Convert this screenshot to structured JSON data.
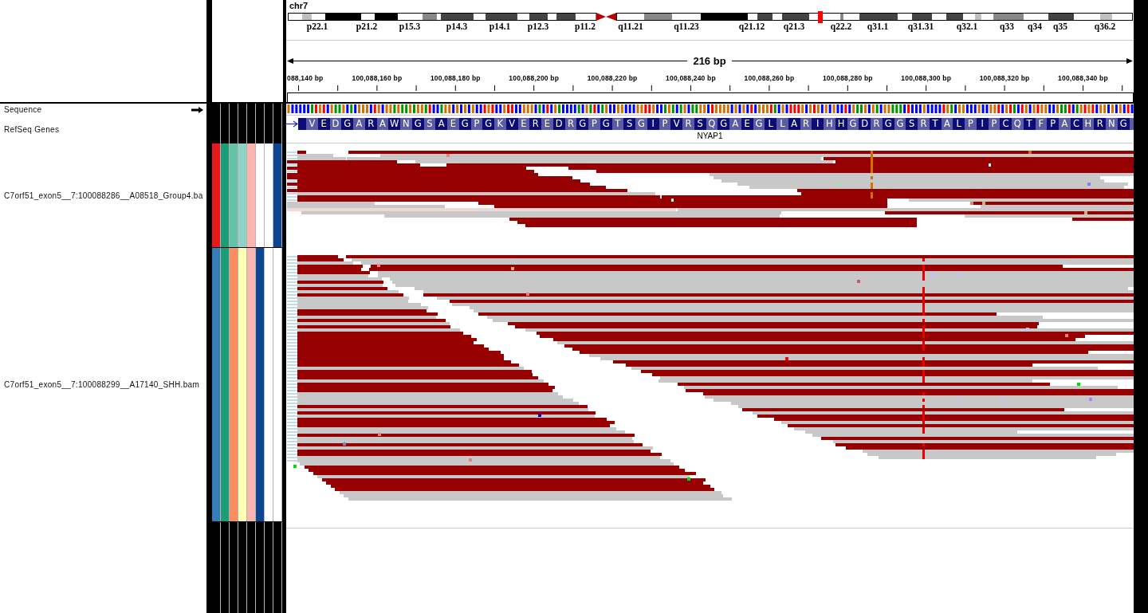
{
  "header": {
    "chromosome": "chr7",
    "band_labels": [
      "p22.1",
      "p21.2",
      "p15.3",
      "p14.3",
      "p14.1",
      "p12.3",
      "p11.2",
      "q11.21",
      "q11.23",
      "q21.12",
      "q21.3",
      "q22.2",
      "q31.1",
      "q31.31",
      "q32.1",
      "q33",
      "q34",
      "q35",
      "q36.2"
    ],
    "ruler": {
      "span": "216 bp",
      "tick_labels": [
        "088,140 bp",
        "100,088,160 bp",
        "100,088,180 bp",
        "100,088,200 bp",
        "100,088,220 bp",
        "100,088,240 bp",
        "100,088,260 bp",
        "100,088,280 bp",
        "100,088,300 bp",
        "100,088,320 bp",
        "100,088,340 bp"
      ]
    }
  },
  "tracks": [
    {
      "kind": "sequence",
      "name": "Sequence"
    },
    {
      "kind": "gene",
      "name": "RefSeq Genes",
      "gene": "NYAP1",
      "amino_acids": [
        "V",
        "E",
        "D",
        "G",
        "A",
        "R",
        "A",
        "W",
        "N",
        "G",
        "S",
        "A",
        "E",
        "G",
        "P",
        "G",
        "K",
        "V",
        "E",
        "R",
        "E",
        "D",
        "R",
        "G",
        "P",
        "G",
        "T",
        "S",
        "G",
        "I",
        "P",
        "V",
        "R",
        "S",
        "Q",
        "G",
        "A",
        "E",
        "G",
        "L",
        "L",
        "A",
        "R",
        "I",
        "H",
        "H",
        "G",
        "D",
        "R",
        "G",
        "G",
        "S",
        "R",
        "T",
        "A",
        "L",
        "P",
        "I",
        "P",
        "C",
        "Q",
        "T",
        "F",
        "P",
        "A",
        "C",
        "H",
        "R",
        "N",
        "G"
      ]
    },
    {
      "kind": "alignment",
      "name": "C7orf51_exon5__7:100088286__A08518_Group4.ba",
      "attributes": [
        {
          "color": "#e41a1c"
        },
        {
          "color": "#1b9e77"
        },
        {
          "color": "#66c2a5"
        },
        {
          "color": "#8dd3c7"
        },
        {
          "color": "#fbb4ae"
        },
        {
          "color": "#ffffff"
        },
        {
          "color": "#ffffff"
        },
        {
          "color": "#0b4594"
        }
      ]
    },
    {
      "kind": "alignment",
      "name": "C7orf51_exon5__7:100088299__A17140_SHH.bam",
      "attributes": [
        {
          "color": "#377eb8"
        },
        {
          "color": "#1b9e77"
        },
        {
          "color": "#fc8d62"
        },
        {
          "color": "#ffffb3"
        },
        {
          "color": "#fbb4ae"
        },
        {
          "color": "#0b4594"
        },
        {
          "color": "#ffffff"
        },
        {
          "color": "#ffffff"
        }
      ]
    }
  ]
}
